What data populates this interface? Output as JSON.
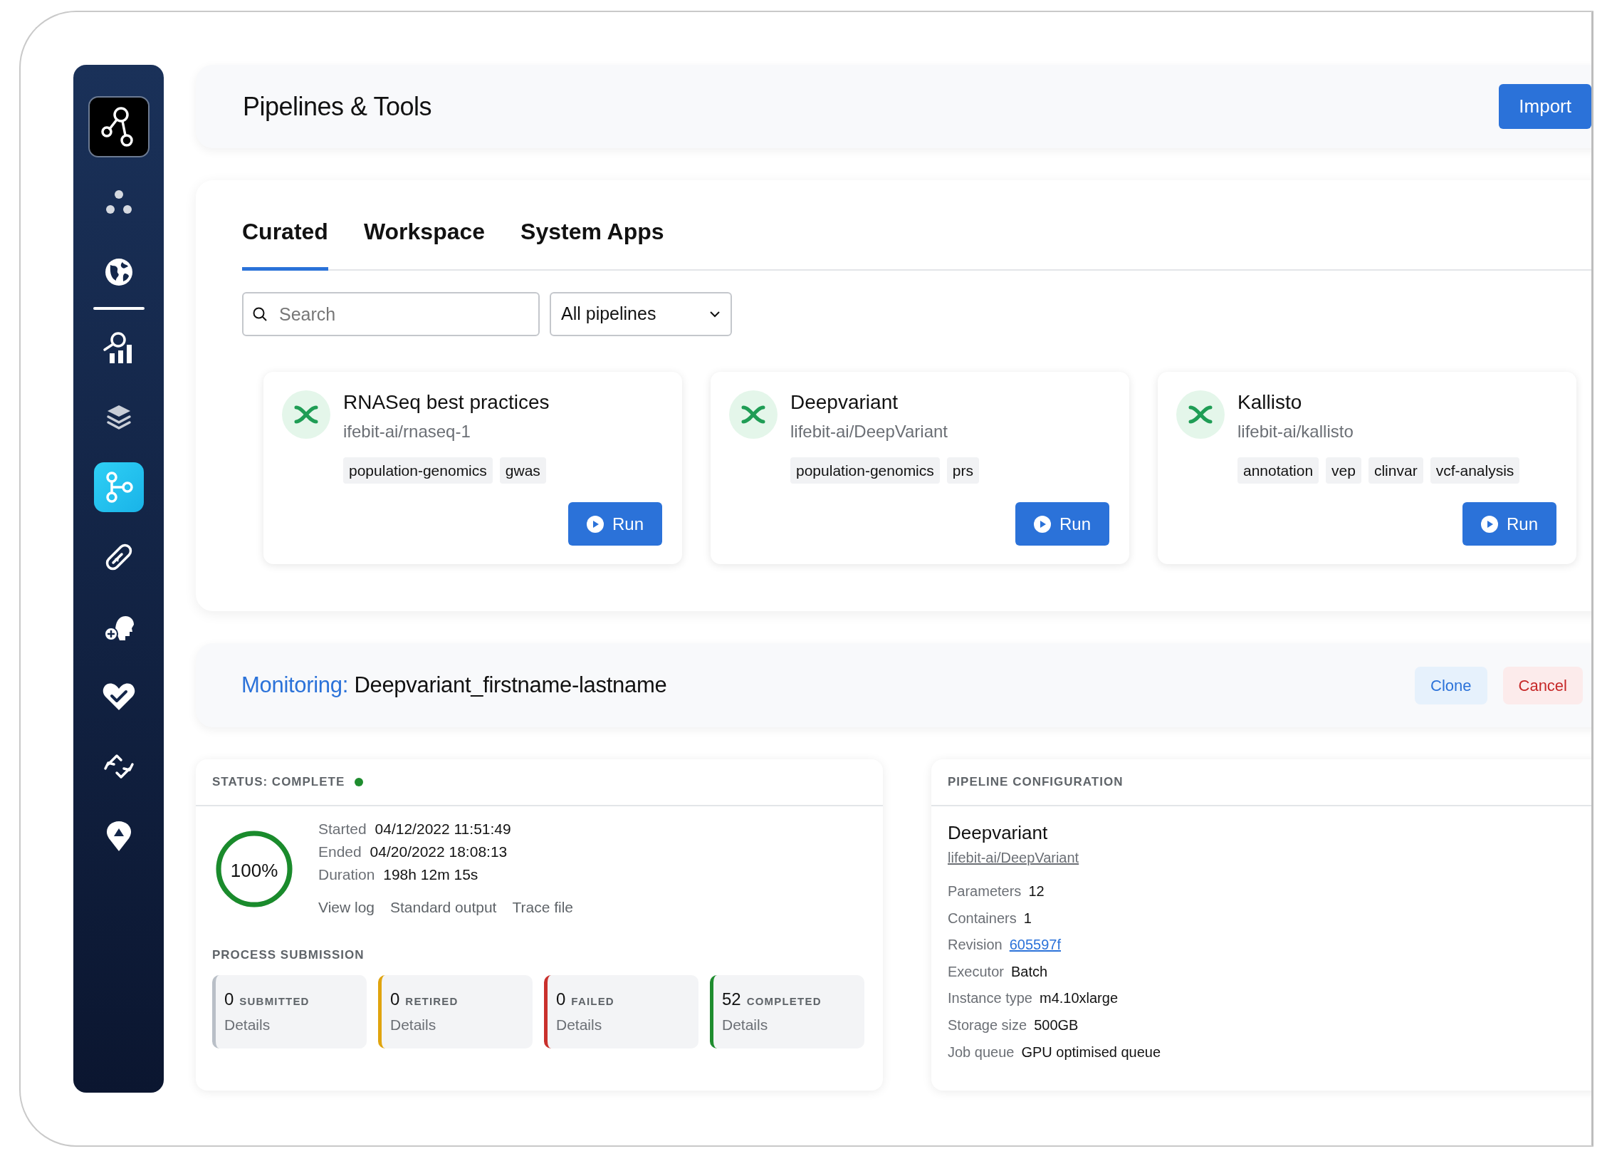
{
  "sidebar": {
    "items": [
      {
        "selected": false
      },
      {
        "selected": false
      },
      {
        "selected": false
      },
      {
        "selected": false
      },
      {
        "selected": true
      },
      {
        "selected": false
      },
      {
        "selected": false
      },
      {
        "selected": false
      },
      {
        "selected": false
      },
      {
        "selected": false
      }
    ]
  },
  "header": {
    "title": "Pipelines & Tools",
    "button": "Import"
  },
  "tabs": [
    {
      "label": "Curated",
      "selected": true
    },
    {
      "label": "Workspace",
      "selected": false
    },
    {
      "label": "System Apps",
      "selected": false
    }
  ],
  "search": {
    "placeholder": "Search"
  },
  "filter": {
    "value": "All pipelines"
  },
  "pipelines": [
    {
      "title": "RNASeq best practices",
      "repo": "ifebit-ai/rnaseq-1",
      "tags": [
        "population-genomics",
        "gwas"
      ],
      "button": "Run"
    },
    {
      "title": "Deepvariant",
      "repo": "lifebit-ai/DeepVariant",
      "tags": [
        "population-genomics",
        "prs"
      ],
      "button": "Run"
    },
    {
      "title": "Kallisto",
      "repo": "lifebit-ai/kallisto",
      "tags": [
        "annotation",
        "vep",
        "clinvar",
        "vcf-analysis"
      ],
      "button": "Run"
    }
  ],
  "monitoring": {
    "label": "Monitoring:",
    "name": "Deepvariant_firstname-lastname",
    "buttons": [
      {
        "label": "Clone",
        "kind": "primary"
      },
      {
        "label": "Cancel",
        "kind": "danger"
      }
    ]
  },
  "status": {
    "title": "STATUS: COMPLETE",
    "progress": {
      "level": 1,
      "label": "100%"
    },
    "times": [
      {
        "label": "Started",
        "value": "04/12/2022 11:51:49"
      },
      {
        "label": "Ended",
        "value": "04/20/2022 18:08:13"
      },
      {
        "label": "Duration",
        "value": "198h 12m 15s"
      }
    ],
    "links": [
      "View log",
      "Standard output",
      "Trace file"
    ],
    "process_title": "PROCESS SUBMISSION",
    "process": [
      {
        "count": "0",
        "label": "SUBMITTED",
        "link": "Details",
        "color": "#b9bfc7"
      },
      {
        "count": "0",
        "label": "RETIRED",
        "link": "Details",
        "color": "#e0a40e"
      },
      {
        "count": "0",
        "label": "FAILED",
        "link": "Details",
        "color": "#c9302c"
      },
      {
        "count": "52",
        "label": "COMPLETED",
        "link": "Details",
        "color": "#1e8c2e"
      }
    ]
  },
  "config": {
    "title": "PIPELINE CONFIGURATION",
    "name": "Deepvariant",
    "repo": "lifebit-ai/DeepVariant",
    "rows": [
      {
        "label": "Parameters",
        "value": "12",
        "kind": "text"
      },
      {
        "label": "Containers",
        "value": "1",
        "kind": "text"
      },
      {
        "label": "Revision",
        "value": "605597f",
        "kind": "link"
      },
      {
        "label": "Executor",
        "value": "Batch",
        "kind": "text"
      },
      {
        "label": "Instance type",
        "value": "m4.10xlarge",
        "kind": "text"
      },
      {
        "label": "Storage size",
        "value": "500GB",
        "kind": "text"
      },
      {
        "label": "Job queue",
        "value": "GPU optimised queue",
        "kind": "text"
      }
    ]
  }
}
